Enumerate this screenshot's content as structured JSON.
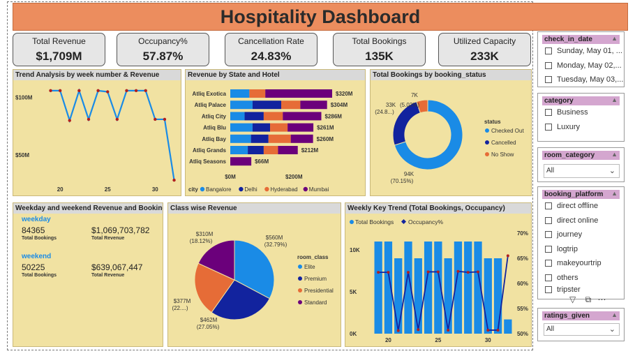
{
  "title": "Hospitality Dashboard",
  "kpis": [
    {
      "label": "Total Revenue",
      "value": "$1,709M"
    },
    {
      "label": "Occupancy%",
      "value": "57.87%"
    },
    {
      "label": "Cancellation Rate",
      "value": "24.83%"
    },
    {
      "label": "Total Bookings",
      "value": "135K"
    },
    {
      "label": "Utilized Capacity",
      "value": "233K"
    }
  ],
  "panels": {
    "trend": "Trend Analysis by week number & Revenue",
    "state": "Revenue by State and Hotel",
    "status": "Total Bookings by booking_status",
    "weekday": "Weekday and weekend Revenue and Booking",
    "classrev": "Class wise Revenue",
    "weekly": "Weekly Key Trend (Total Bookings, Occupancy)"
  },
  "weekday_weekend": {
    "weekday": {
      "label": "weekday",
      "bookings": "84365",
      "revenue": "$1,069,703,782",
      "bookings_label": "Total Bookings",
      "revenue_label": "Total Revenue"
    },
    "weekend": {
      "label": "weekend",
      "bookings": "50225",
      "revenue": "$639,067,447",
      "bookings_label": "Total Bookings",
      "revenue_label": "Total Revenue"
    }
  },
  "slicers": {
    "check_in_date": {
      "label": "check_in_date",
      "options": [
        "Sunday, May 01, ...",
        "Monday, May 02,...",
        "Tuesday, May 03,..."
      ]
    },
    "category": {
      "label": "category",
      "options": [
        "Business",
        "Luxury"
      ]
    },
    "room_category": {
      "label": "room_category",
      "value": "All"
    },
    "booking_platform": {
      "label": "booking_platform",
      "options": [
        "direct offline",
        "direct online",
        "journey",
        "logtrip",
        "makeyourtrip",
        "others",
        "tripster"
      ]
    },
    "ratings_given": {
      "label": "ratings_given",
      "value": "All"
    }
  },
  "icons": {
    "filter": "filter-icon",
    "focus": "focus-mode-icon",
    "more": "more-options-icon"
  },
  "colors": {
    "bangalore": "#1a8be6",
    "delhi": "#12239e",
    "hyderabad": "#e66c37",
    "mumbai": "#6b007b",
    "panel": "#f1e2a2",
    "title": "#ec8d5e"
  },
  "chart_data": [
    {
      "id": "trend",
      "type": "line",
      "x": [
        19,
        20,
        21,
        22,
        23,
        24,
        25,
        26,
        27,
        28,
        29,
        30,
        31,
        32
      ],
      "values": [
        106,
        106,
        80,
        106,
        81,
        106,
        105,
        81,
        106,
        106,
        106,
        81,
        81,
        28
      ],
      "x_ticks": [
        20,
        25,
        30
      ],
      "y_ticks": [
        {
          "v": 100,
          "label": "$100M"
        },
        {
          "v": 50,
          "label": "$50M"
        }
      ],
      "ylim": [
        25,
        112
      ],
      "xlim": [
        18.3,
        32.4
      ]
    },
    {
      "id": "state",
      "type": "bar",
      "orientation": "horizontal",
      "stacked": true,
      "categories": [
        "Atliq Exotica",
        "Atliq Palace",
        "Atliq City",
        "Atliq Blu",
        "Atliq Bay",
        "Atliq Grands",
        "Atliq Seasons"
      ],
      "totals": [
        "$320M",
        "$304M",
        "$286M",
        "$261M",
        "$260M",
        "$212M",
        "$66M"
      ],
      "series": [
        {
          "name": "Bangalore",
          "values": [
            60,
            70,
            45,
            70,
            65,
            55,
            0
          ]
        },
        {
          "name": "Delhi",
          "values": [
            0,
            90,
            60,
            55,
            55,
            50,
            0
          ]
        },
        {
          "name": "Hyderabad",
          "values": [
            50,
            60,
            60,
            55,
            70,
            45,
            0
          ]
        },
        {
          "name": "Mumbai",
          "values": [
            210,
            84,
            121,
            81,
            70,
            62,
            66
          ]
        }
      ],
      "x_ticks": [
        {
          "v": 0,
          "label": "$0M"
        },
        {
          "v": 200,
          "label": "$200M"
        }
      ],
      "xlim": [
        0,
        320
      ],
      "legend_title": "city"
    },
    {
      "id": "status",
      "type": "pie",
      "donut": true,
      "slices": [
        {
          "name": "Checked Out",
          "value": 94,
          "label": "94K",
          "pct": "(70.15%)"
        },
        {
          "name": "Cancelled",
          "value": 33,
          "label": "33K",
          "pct": "(24.8...)"
        },
        {
          "name": "No Show",
          "value": 7,
          "label": "7K",
          "pct": "(5.02%)"
        }
      ],
      "legend_title": "status"
    },
    {
      "id": "classrev",
      "type": "pie",
      "slices": [
        {
          "name": "Elite",
          "value": 560,
          "label": "$560M",
          "pct": "(32.79%)"
        },
        {
          "name": "Premium",
          "value": 462,
          "label": "$462M",
          "pct": "(27.05%)"
        },
        {
          "name": "Presidential",
          "value": 377,
          "label": "$377M",
          "pct": "(22....)"
        },
        {
          "name": "Standard",
          "value": 310,
          "label": "$310M",
          "pct": "(18.12%)"
        }
      ],
      "legend_title": "room_class"
    },
    {
      "id": "weekly",
      "type": "bar",
      "combo": true,
      "x": [
        19,
        20,
        21,
        22,
        23,
        24,
        25,
        26,
        27,
        28,
        29,
        30,
        31,
        32
      ],
      "series": [
        {
          "name": "Total Bookings",
          "type": "bar",
          "values": [
            11000,
            11000,
            9000,
            11000,
            9000,
            11000,
            11000,
            9000,
            11000,
            11000,
            11000,
            9000,
            9000,
            1700
          ]
        },
        {
          "name": "Occupancy%",
          "type": "line",
          "values": [
            62.2,
            62.2,
            50.6,
            62.2,
            50.8,
            62.3,
            62.3,
            50.7,
            62.4,
            62.2,
            62.3,
            50.7,
            50.7,
            65.5
          ]
        }
      ],
      "x_ticks": [
        20,
        25,
        30
      ],
      "y_ticks": [
        {
          "v": 10000,
          "label": "10K"
        },
        {
          "v": 5000,
          "label": "5K"
        },
        {
          "v": 0,
          "label": "0K"
        }
      ],
      "y2_ticks": [
        {
          "v": 70,
          "label": "70%"
        },
        {
          "v": 65,
          "label": "65%"
        },
        {
          "v": 60,
          "label": "60%"
        },
        {
          "v": 55,
          "label": "55%"
        },
        {
          "v": 50,
          "label": "50%"
        }
      ],
      "ylim": [
        0,
        12000
      ],
      "y2lim": [
        50,
        70
      ]
    }
  ]
}
